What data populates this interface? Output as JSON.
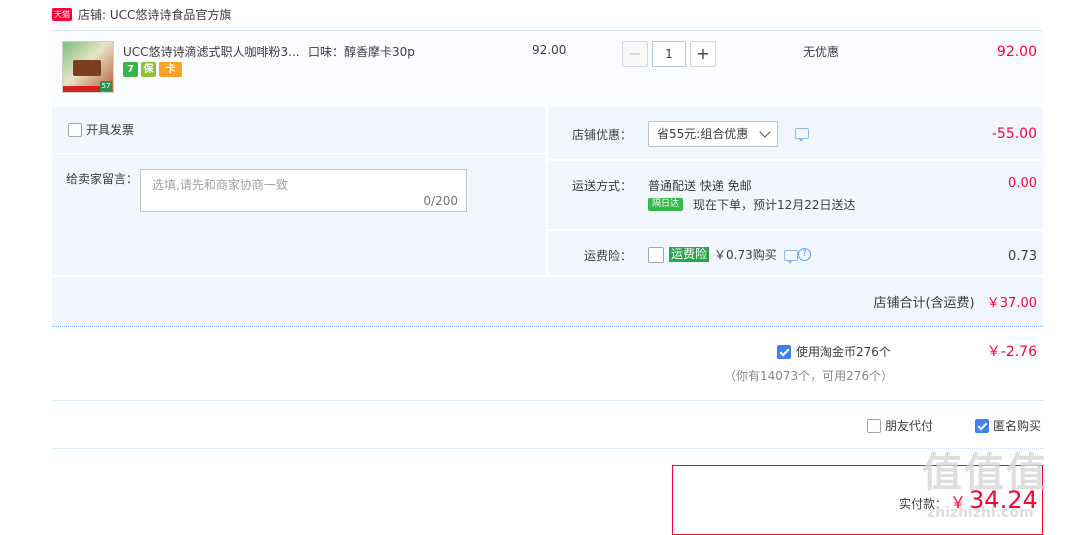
{
  "shop": {
    "badge": "天猫",
    "label": "店铺: UCC悠诗诗食品官方旗"
  },
  "item": {
    "title": "UCC悠诗诗滴滤式职人咖啡粉3...",
    "spec": "口味：醇香摩卡30p",
    "unit_price": "92.00",
    "quantity": "1",
    "minus": "−",
    "plus": "+",
    "promotion": "无优惠",
    "subtotal": "92.00",
    "thumb_tag": "57",
    "badges": [
      "7",
      "保",
      "卡"
    ]
  },
  "options": {
    "invoice_label": "开具发票",
    "message_label": "给卖家留言：",
    "message_placeholder": "选填,请先和商家协商一致",
    "message_count": "0/200",
    "discount_label": "店铺优惠：",
    "discount_value": "省55元:组合优惠",
    "discount_amount": "-55.00",
    "shipping_label": "运送方式：",
    "shipping_value": "普通配送 快递 免邮",
    "nextday_badge": "隔日达",
    "delivery_note": "现在下单，预计12月22日送达",
    "shipping_amount": "0.00",
    "insurance_label": "运费险：",
    "insurance_badge": "运费险",
    "insurance_price": "￥0.73购买",
    "insurance_amount": "0.73",
    "shop_total_label": "店铺合计(含运费)",
    "shop_total_value": "￥37.00"
  },
  "coins": {
    "label": "使用淘金币276个",
    "amount": "￥-2.76",
    "note": "（你有14073个，可用276个）",
    "checked": true
  },
  "pay_options": {
    "friend_pay": "朋友代付",
    "anonymous": "匿名购买",
    "anonymous_checked": true
  },
  "final": {
    "label": "实付款：",
    "currency": "￥",
    "amount": "34.24"
  },
  "watermark": {
    "main": "值值值",
    "sub": "zhizhizhi.com"
  },
  "colors": {
    "accent_red": "#ff0036",
    "checkbox_blue": "#3c82f5",
    "panel_bg": "#f2f7ff"
  }
}
